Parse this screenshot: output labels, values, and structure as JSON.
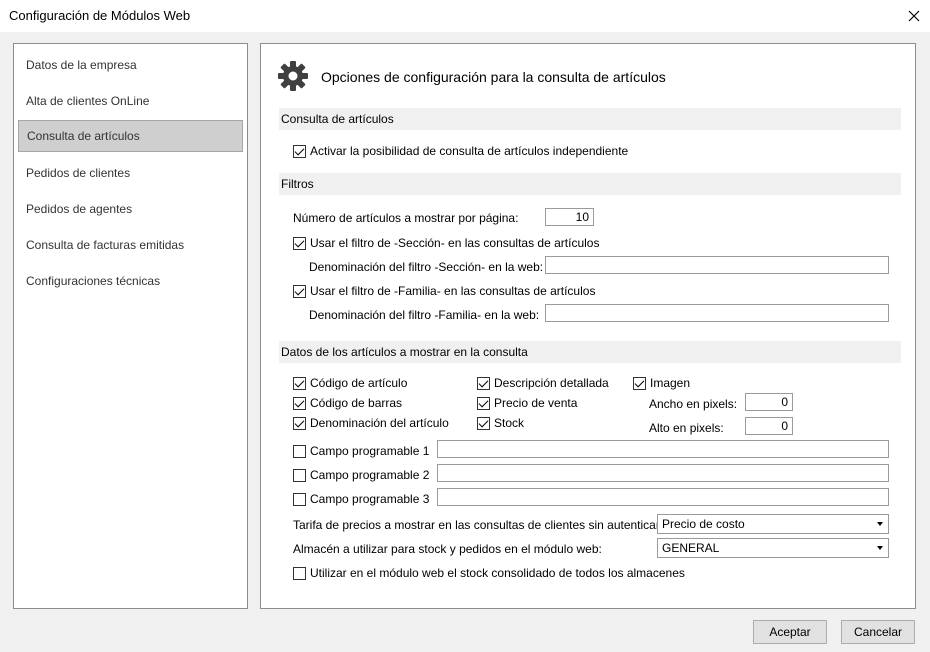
{
  "window": {
    "title": "Configuración de Módulos Web"
  },
  "sidebar": {
    "items": [
      {
        "label": "Datos de la empresa",
        "selected": false
      },
      {
        "label": "Alta de clientes OnLine",
        "selected": false
      },
      {
        "label": "Consulta de artículos",
        "selected": true
      },
      {
        "label": "Pedidos de clientes",
        "selected": false
      },
      {
        "label": "Pedidos de agentes",
        "selected": false
      },
      {
        "label": "Consulta de facturas emitidas",
        "selected": false
      },
      {
        "label": "Configuraciones técnicas",
        "selected": false
      }
    ]
  },
  "panel": {
    "title": "Opciones de configuración para la consulta de artículos",
    "sections": {
      "consulta": "Consulta de artículos",
      "filtros": "Filtros",
      "datos": "Datos de los artículos a mostrar en la consulta"
    },
    "consulta": {
      "activar_label": "Activar la posibilidad de consulta de artículos independiente",
      "activar_checked": true
    },
    "filtros": {
      "num_articulos_label": "Número de artículos a mostrar por página:",
      "num_articulos_value": "10",
      "seccion_label": "Usar el filtro de -Sección- en las consultas de artículos",
      "seccion_checked": true,
      "seccion_den_label": "Denominación del filtro -Sección- en la web:",
      "seccion_den_value": "",
      "familia_label": "Usar el filtro de -Familia- en las consultas de artículos",
      "familia_checked": true,
      "familia_den_label": "Denominación del filtro -Familia- en la web:",
      "familia_den_value": ""
    },
    "datos": {
      "codigo_articulo": "Código de artículo",
      "codigo_barras": "Código de barras",
      "denominacion": "Denominación del artículo",
      "descripcion": "Descripción detallada",
      "precio_venta": "Precio de venta",
      "stock": "Stock",
      "imagen": "Imagen",
      "ancho_label": "Ancho en pixels:",
      "ancho_value": "0",
      "alto_label": "Alto en pixels:",
      "alto_value": "0",
      "campo1": "Campo programable 1",
      "campo2": "Campo programable 2",
      "campo3": "Campo programable 3",
      "campo1_value": "",
      "campo2_value": "",
      "campo3_value": "",
      "tarifa_label": "Tarifa de precios a mostrar en las consultas de clientes sin autenticar:",
      "tarifa_value": "Precio de costo",
      "almacen_label": "Almacén a utilizar para stock y pedidos en el módulo web:",
      "almacen_value": "GENERAL",
      "consolidado_label": "Utilizar en el módulo web el stock consolidado de todos los almacenes",
      "consolidado_checked": false
    }
  },
  "buttons": {
    "accept": "Aceptar",
    "cancel": "Cancelar"
  }
}
